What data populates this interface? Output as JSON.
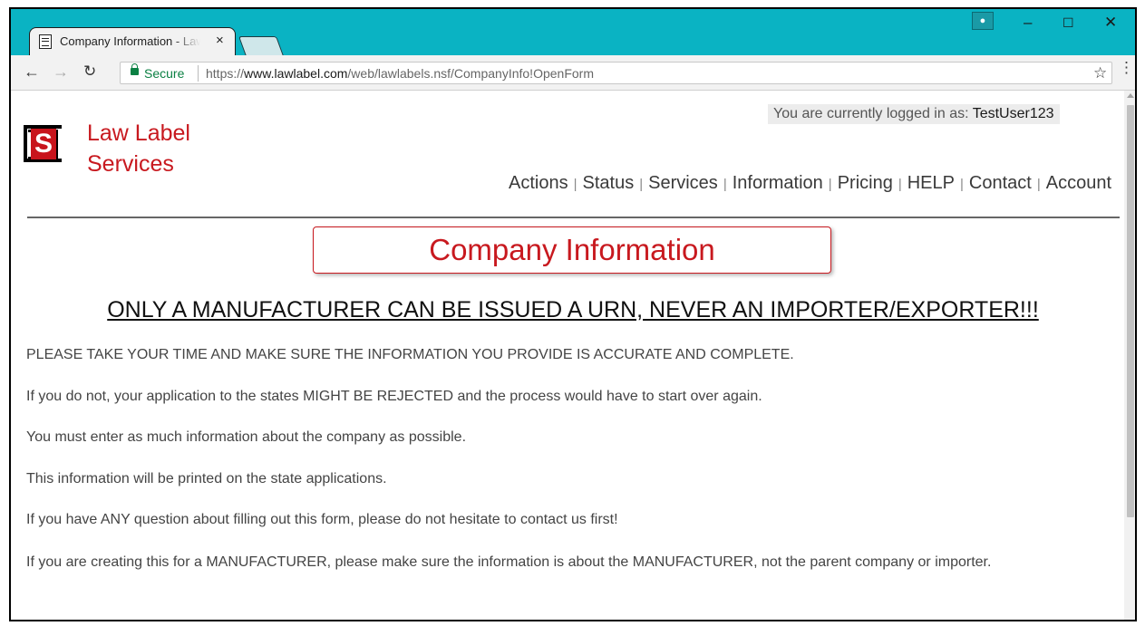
{
  "browser": {
    "tab_title": "Company Information - Law Label Services",
    "tab_close": "×",
    "url_secure_label": "Secure",
    "url_prefix": "https://",
    "url_host": "www.lawlabel.com",
    "url_path": "/web/lawlabels.nsf/CompanyInfo!OpenForm"
  },
  "header": {
    "brand_line1": "Law Label",
    "brand_line2": "Services",
    "logo_letter": "S",
    "logged_in_label": "You are currently logged in as:",
    "username": "TestUser123",
    "nav": [
      "Actions",
      "Status",
      "Services",
      "Information",
      "Pricing",
      "HELP",
      "Contact",
      "Account"
    ],
    "nav_separator": "|"
  },
  "main": {
    "page_title": "Company Information",
    "warning": "ONLY A MANUFACTURER CAN BE ISSUED A URN, NEVER AN IMPORTER/EXPORTER!!!",
    "paragraphs": [
      "PLEASE TAKE YOUR TIME AND MAKE SURE THE INFORMATION YOU PROVIDE IS ACCURATE AND COMPLETE.",
      "If you do not, your application to the states MIGHT BE REJECTED and the process would have to start over again.",
      "You must enter as much information about the company as possible.",
      "This information will be printed on the state applications.",
      "If you have ANY question about filling out this form, please do not hesitate to contact us first!",
      "If you are creating this for a MANUFACTURER, please make sure the information is about the MANUFACTURER, not the parent company or importer."
    ]
  },
  "colors": {
    "titlebar": "#0ab3c3",
    "brand_red": "#c8191f",
    "secure_green": "#0b8043"
  }
}
